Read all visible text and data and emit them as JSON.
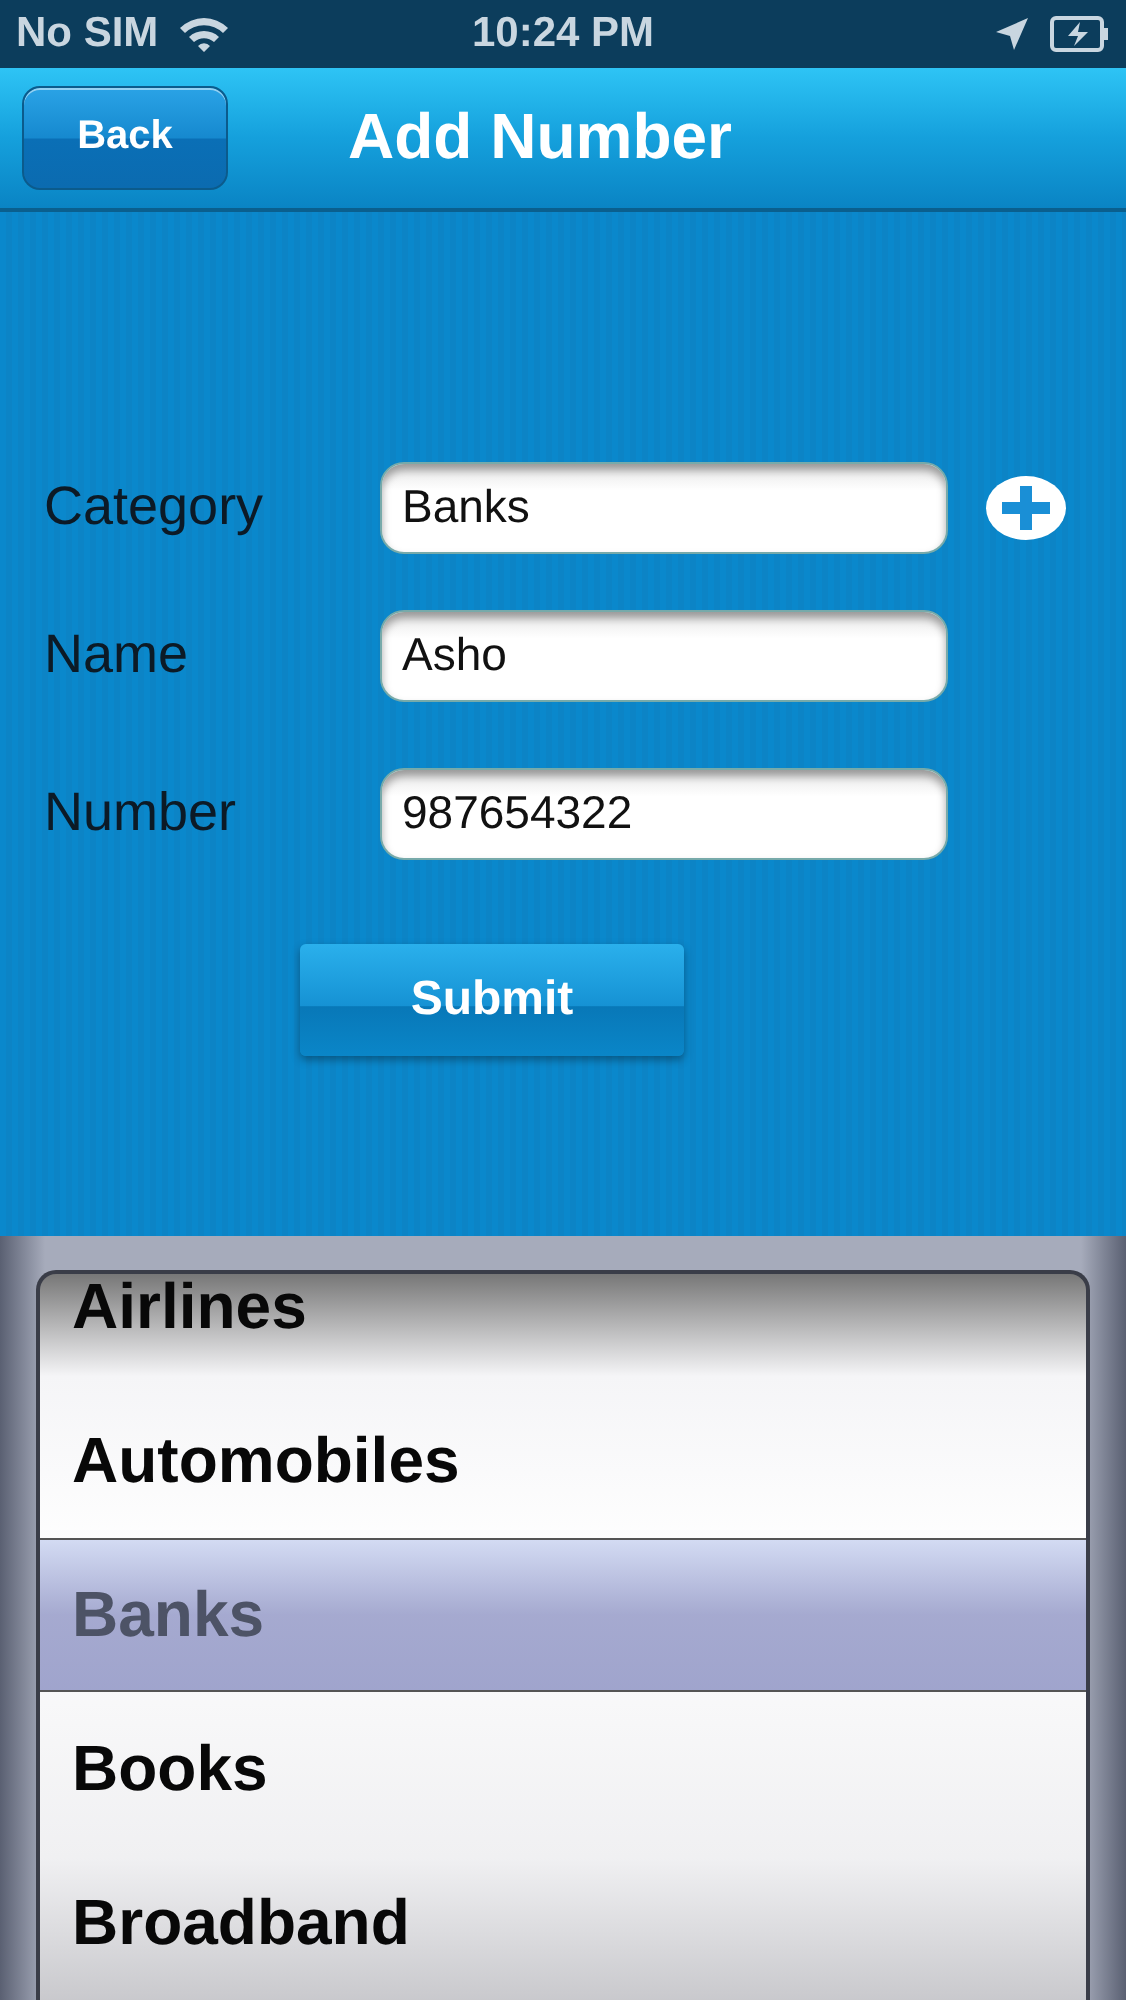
{
  "status_bar": {
    "carrier": "No SIM",
    "time": "10:24 PM"
  },
  "nav_bar": {
    "back": "Back",
    "title": "Add Number"
  },
  "form": {
    "fields": [
      {
        "label": "Category",
        "value": "Banks",
        "has_add": true
      },
      {
        "label": "Name",
        "value": "Asho",
        "has_add": false
      },
      {
        "label": "Number",
        "value": "987654322",
        "has_add": false
      }
    ],
    "submit": "Submit"
  },
  "picker": {
    "items": [
      {
        "label": "Airlines",
        "selected": false
      },
      {
        "label": "Automobiles",
        "selected": false
      },
      {
        "label": "Banks",
        "selected": true
      },
      {
        "label": "Books",
        "selected": false
      },
      {
        "label": "Broadband",
        "selected": false
      }
    ]
  }
}
